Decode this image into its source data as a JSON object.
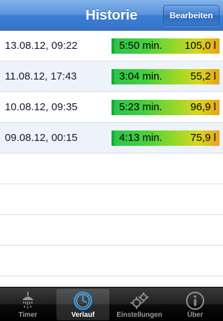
{
  "navbar": {
    "title": "Historie",
    "edit_button": "Bearbeiten"
  },
  "entries": [
    {
      "date": "13.08.12, 09:22",
      "duration": "5:50 min.",
      "volume": "105,0 l"
    },
    {
      "date": "11.08.12, 17:43",
      "duration": "3:04 min.",
      "volume": "55,2 l"
    },
    {
      "date": "10.08.12, 09:35",
      "duration": "5:23 min.",
      "volume": "96,9 l"
    },
    {
      "date": "09.08.12, 00:15",
      "duration": "4:13 min.",
      "volume": "75,9 l"
    }
  ],
  "tabs": [
    {
      "label": "Timer",
      "icon": "shower-icon"
    },
    {
      "label": "Verlauf",
      "icon": "clock-icon",
      "selected": true
    },
    {
      "label": "Einstellungen",
      "icon": "gears-icon"
    },
    {
      "label": "Über",
      "icon": "info-icon"
    }
  ],
  "colors": {
    "navbar": "#4a86d6",
    "bar_start": "#2ac44a",
    "bar_end": "#e6a41a",
    "tabbar": "#1a1a1a"
  }
}
